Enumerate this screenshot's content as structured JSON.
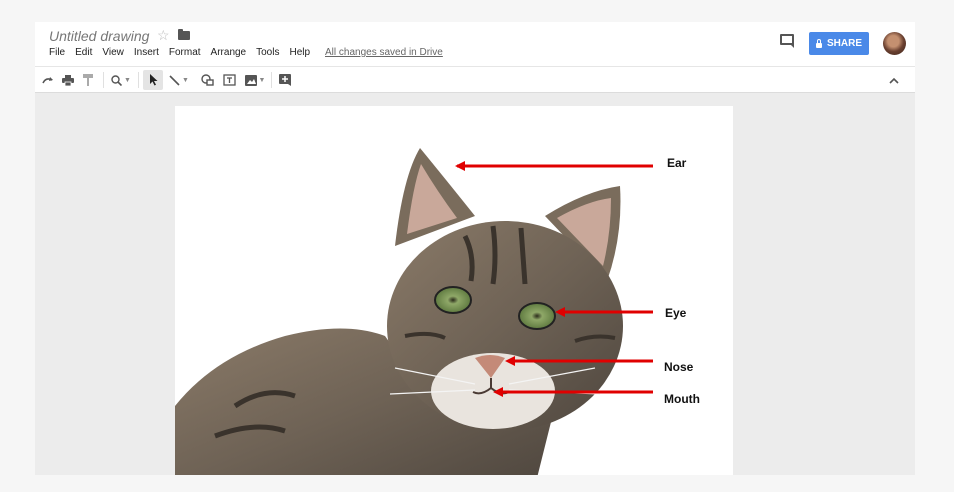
{
  "document": {
    "title": "Untitled drawing",
    "saved_status": "All changes saved in Drive"
  },
  "menu": {
    "items": [
      "File",
      "Edit",
      "View",
      "Insert",
      "Format",
      "Arrange",
      "Tools",
      "Help"
    ]
  },
  "header": {
    "share_label": "SHARE"
  },
  "toolbar": {
    "icons": [
      "redo-icon",
      "print-icon",
      "paint-format-icon",
      "zoom-icon",
      "select-icon",
      "line-icon",
      "shape-icon",
      "text-box-icon",
      "image-icon",
      "add-comment-icon"
    ]
  },
  "diagram": {
    "labels": {
      "ear": "Ear",
      "eye": "Eye",
      "nose": "Nose",
      "mouth": "Mouth"
    },
    "arrow_color": "#e00000"
  },
  "colors": {
    "accent": "#4a89e8",
    "canvas_bg": "#ececec"
  }
}
